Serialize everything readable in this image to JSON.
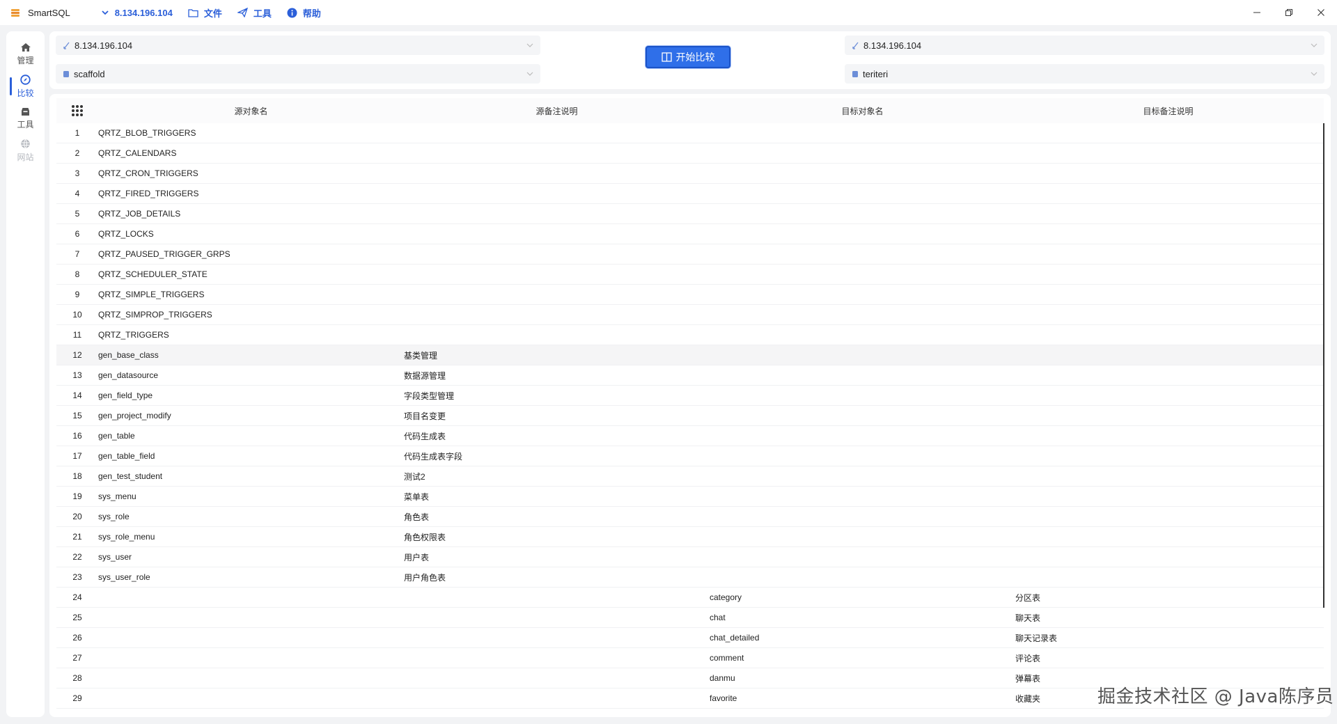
{
  "app": {
    "name": "SmartSQL"
  },
  "menu": {
    "connection": "8.134.196.104",
    "file": "文件",
    "tools": "工具",
    "help": "帮助"
  },
  "nav": [
    {
      "label": "管理",
      "icon": "home-icon"
    },
    {
      "label": "比较",
      "icon": "compass-icon"
    },
    {
      "label": "工具",
      "icon": "toolbox-icon"
    },
    {
      "label": "网站",
      "icon": "globe-icon"
    }
  ],
  "source": {
    "server": "8.134.196.104",
    "database": "scaffold"
  },
  "target": {
    "server": "8.134.196.104",
    "database": "teriteri"
  },
  "compare_button": "开始比较",
  "table": {
    "headers": [
      "源对象名",
      "源备注说明",
      "目标对象名",
      "目标备注说明"
    ],
    "rows": [
      [
        "1",
        "QRTZ_BLOB_TRIGGERS",
        "",
        "",
        ""
      ],
      [
        "2",
        "QRTZ_CALENDARS",
        "",
        "",
        ""
      ],
      [
        "3",
        "QRTZ_CRON_TRIGGERS",
        "",
        "",
        ""
      ],
      [
        "4",
        "QRTZ_FIRED_TRIGGERS",
        "",
        "",
        ""
      ],
      [
        "5",
        "QRTZ_JOB_DETAILS",
        "",
        "",
        ""
      ],
      [
        "6",
        "QRTZ_LOCKS",
        "",
        "",
        ""
      ],
      [
        "7",
        "QRTZ_PAUSED_TRIGGER_GRPS",
        "",
        "",
        ""
      ],
      [
        "8",
        "QRTZ_SCHEDULER_STATE",
        "",
        "",
        ""
      ],
      [
        "9",
        "QRTZ_SIMPLE_TRIGGERS",
        "",
        "",
        ""
      ],
      [
        "10",
        "QRTZ_SIMPROP_TRIGGERS",
        "",
        "",
        ""
      ],
      [
        "11",
        "QRTZ_TRIGGERS",
        "",
        "",
        ""
      ],
      [
        "12",
        "gen_base_class",
        "基类管理",
        "",
        ""
      ],
      [
        "13",
        "gen_datasource",
        "数据源管理",
        "",
        ""
      ],
      [
        "14",
        "gen_field_type",
        "字段类型管理",
        "",
        ""
      ],
      [
        "15",
        "gen_project_modify",
        "项目名变更",
        "",
        ""
      ],
      [
        "16",
        "gen_table",
        "代码生成表",
        "",
        ""
      ],
      [
        "17",
        "gen_table_field",
        "代码生成表字段",
        "",
        ""
      ],
      [
        "18",
        "gen_test_student",
        "测试2",
        "",
        ""
      ],
      [
        "19",
        "sys_menu",
        "菜单表",
        "",
        ""
      ],
      [
        "20",
        "sys_role",
        "角色表",
        "",
        ""
      ],
      [
        "21",
        "sys_role_menu",
        "角色权限表",
        "",
        ""
      ],
      [
        "22",
        "sys_user",
        "用户表",
        "",
        ""
      ],
      [
        "23",
        "sys_user_role",
        "用户角色表",
        "",
        ""
      ],
      [
        "24",
        "",
        "",
        "category",
        "分区表"
      ],
      [
        "25",
        "",
        "",
        "chat",
        "聊天表"
      ],
      [
        "26",
        "",
        "",
        "chat_detailed",
        "聊天记录表"
      ],
      [
        "27",
        "",
        "",
        "comment",
        "评论表"
      ],
      [
        "28",
        "",
        "",
        "danmu",
        "弹幕表"
      ],
      [
        "29",
        "",
        "",
        "favorite",
        "收藏夹"
      ]
    ],
    "highlighted_row": 12
  },
  "watermark": "掘金技术社区 @ Java陈序员",
  "colors": {
    "accent": "#2b5fd9",
    "button": "#2f6fe9"
  }
}
